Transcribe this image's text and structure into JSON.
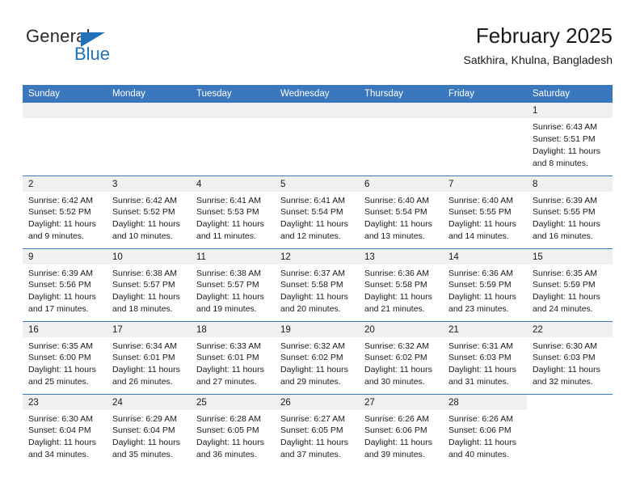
{
  "brand": {
    "name_top": "General",
    "name_bottom": "Blue",
    "triangle_color": "#2272b8"
  },
  "header": {
    "title": "February 2025",
    "subtitle": "Satkhira, Khulna, Bangladesh"
  },
  "theme": {
    "header_blue": "#3b77bd",
    "daynum_gray": "#f0f0f0",
    "text": "#1a1a1a"
  },
  "weekdays": [
    "Sunday",
    "Monday",
    "Tuesday",
    "Wednesday",
    "Thursday",
    "Friday",
    "Saturday"
  ],
  "labels": {
    "sunrise": "Sunrise:",
    "sunset": "Sunset:",
    "daylight": "Daylight:"
  },
  "weeks": [
    [
      {
        "day": "",
        "state": "blank"
      },
      {
        "day": "",
        "state": "blank"
      },
      {
        "day": "",
        "state": "blank"
      },
      {
        "day": "",
        "state": "blank"
      },
      {
        "day": "",
        "state": "blank"
      },
      {
        "day": "",
        "state": "blank"
      },
      {
        "day": "1",
        "state": "filled",
        "sunrise": "Sunrise: 6:43 AM",
        "sunset": "Sunset: 5:51 PM",
        "daylight_line1": "Daylight: 11 hours",
        "daylight_line2": "and 8 minutes."
      }
    ],
    [
      {
        "day": "2",
        "state": "filled",
        "sunrise": "Sunrise: 6:42 AM",
        "sunset": "Sunset: 5:52 PM",
        "daylight_line1": "Daylight: 11 hours",
        "daylight_line2": "and 9 minutes."
      },
      {
        "day": "3",
        "state": "filled",
        "sunrise": "Sunrise: 6:42 AM",
        "sunset": "Sunset: 5:52 PM",
        "daylight_line1": "Daylight: 11 hours",
        "daylight_line2": "and 10 minutes."
      },
      {
        "day": "4",
        "state": "filled",
        "sunrise": "Sunrise: 6:41 AM",
        "sunset": "Sunset: 5:53 PM",
        "daylight_line1": "Daylight: 11 hours",
        "daylight_line2": "and 11 minutes."
      },
      {
        "day": "5",
        "state": "filled",
        "sunrise": "Sunrise: 6:41 AM",
        "sunset": "Sunset: 5:54 PM",
        "daylight_line1": "Daylight: 11 hours",
        "daylight_line2": "and 12 minutes."
      },
      {
        "day": "6",
        "state": "filled",
        "sunrise": "Sunrise: 6:40 AM",
        "sunset": "Sunset: 5:54 PM",
        "daylight_line1": "Daylight: 11 hours",
        "daylight_line2": "and 13 minutes."
      },
      {
        "day": "7",
        "state": "filled",
        "sunrise": "Sunrise: 6:40 AM",
        "sunset": "Sunset: 5:55 PM",
        "daylight_line1": "Daylight: 11 hours",
        "daylight_line2": "and 14 minutes."
      },
      {
        "day": "8",
        "state": "filled",
        "sunrise": "Sunrise: 6:39 AM",
        "sunset": "Sunset: 5:55 PM",
        "daylight_line1": "Daylight: 11 hours",
        "daylight_line2": "and 16 minutes."
      }
    ],
    [
      {
        "day": "9",
        "state": "filled",
        "sunrise": "Sunrise: 6:39 AM",
        "sunset": "Sunset: 5:56 PM",
        "daylight_line1": "Daylight: 11 hours",
        "daylight_line2": "and 17 minutes."
      },
      {
        "day": "10",
        "state": "filled",
        "sunrise": "Sunrise: 6:38 AM",
        "sunset": "Sunset: 5:57 PM",
        "daylight_line1": "Daylight: 11 hours",
        "daylight_line2": "and 18 minutes."
      },
      {
        "day": "11",
        "state": "filled",
        "sunrise": "Sunrise: 6:38 AM",
        "sunset": "Sunset: 5:57 PM",
        "daylight_line1": "Daylight: 11 hours",
        "daylight_line2": "and 19 minutes."
      },
      {
        "day": "12",
        "state": "filled",
        "sunrise": "Sunrise: 6:37 AM",
        "sunset": "Sunset: 5:58 PM",
        "daylight_line1": "Daylight: 11 hours",
        "daylight_line2": "and 20 minutes."
      },
      {
        "day": "13",
        "state": "filled",
        "sunrise": "Sunrise: 6:36 AM",
        "sunset": "Sunset: 5:58 PM",
        "daylight_line1": "Daylight: 11 hours",
        "daylight_line2": "and 21 minutes."
      },
      {
        "day": "14",
        "state": "filled",
        "sunrise": "Sunrise: 6:36 AM",
        "sunset": "Sunset: 5:59 PM",
        "daylight_line1": "Daylight: 11 hours",
        "daylight_line2": "and 23 minutes."
      },
      {
        "day": "15",
        "state": "filled",
        "sunrise": "Sunrise: 6:35 AM",
        "sunset": "Sunset: 5:59 PM",
        "daylight_line1": "Daylight: 11 hours",
        "daylight_line2": "and 24 minutes."
      }
    ],
    [
      {
        "day": "16",
        "state": "filled",
        "sunrise": "Sunrise: 6:35 AM",
        "sunset": "Sunset: 6:00 PM",
        "daylight_line1": "Daylight: 11 hours",
        "daylight_line2": "and 25 minutes."
      },
      {
        "day": "17",
        "state": "filled",
        "sunrise": "Sunrise: 6:34 AM",
        "sunset": "Sunset: 6:01 PM",
        "daylight_line1": "Daylight: 11 hours",
        "daylight_line2": "and 26 minutes."
      },
      {
        "day": "18",
        "state": "filled",
        "sunrise": "Sunrise: 6:33 AM",
        "sunset": "Sunset: 6:01 PM",
        "daylight_line1": "Daylight: 11 hours",
        "daylight_line2": "and 27 minutes."
      },
      {
        "day": "19",
        "state": "filled",
        "sunrise": "Sunrise: 6:32 AM",
        "sunset": "Sunset: 6:02 PM",
        "daylight_line1": "Daylight: 11 hours",
        "daylight_line2": "and 29 minutes."
      },
      {
        "day": "20",
        "state": "filled",
        "sunrise": "Sunrise: 6:32 AM",
        "sunset": "Sunset: 6:02 PM",
        "daylight_line1": "Daylight: 11 hours",
        "daylight_line2": "and 30 minutes."
      },
      {
        "day": "21",
        "state": "filled",
        "sunrise": "Sunrise: 6:31 AM",
        "sunset": "Sunset: 6:03 PM",
        "daylight_line1": "Daylight: 11 hours",
        "daylight_line2": "and 31 minutes."
      },
      {
        "day": "22",
        "state": "filled",
        "sunrise": "Sunrise: 6:30 AM",
        "sunset": "Sunset: 6:03 PM",
        "daylight_line1": "Daylight: 11 hours",
        "daylight_line2": "and 32 minutes."
      }
    ],
    [
      {
        "day": "23",
        "state": "filled",
        "sunrise": "Sunrise: 6:30 AM",
        "sunset": "Sunset: 6:04 PM",
        "daylight_line1": "Daylight: 11 hours",
        "daylight_line2": "and 34 minutes."
      },
      {
        "day": "24",
        "state": "filled",
        "sunrise": "Sunrise: 6:29 AM",
        "sunset": "Sunset: 6:04 PM",
        "daylight_line1": "Daylight: 11 hours",
        "daylight_line2": "and 35 minutes."
      },
      {
        "day": "25",
        "state": "filled",
        "sunrise": "Sunrise: 6:28 AM",
        "sunset": "Sunset: 6:05 PM",
        "daylight_line1": "Daylight: 11 hours",
        "daylight_line2": "and 36 minutes."
      },
      {
        "day": "26",
        "state": "filled",
        "sunrise": "Sunrise: 6:27 AM",
        "sunset": "Sunset: 6:05 PM",
        "daylight_line1": "Daylight: 11 hours",
        "daylight_line2": "and 37 minutes."
      },
      {
        "day": "27",
        "state": "filled",
        "sunrise": "Sunrise: 6:26 AM",
        "sunset": "Sunset: 6:06 PM",
        "daylight_line1": "Daylight: 11 hours",
        "daylight_line2": "and 39 minutes."
      },
      {
        "day": "28",
        "state": "filled",
        "sunrise": "Sunrise: 6:26 AM",
        "sunset": "Sunset: 6:06 PM",
        "daylight_line1": "Daylight: 11 hours",
        "daylight_line2": "and 40 minutes."
      },
      {
        "day": "",
        "state": "void"
      }
    ]
  ]
}
